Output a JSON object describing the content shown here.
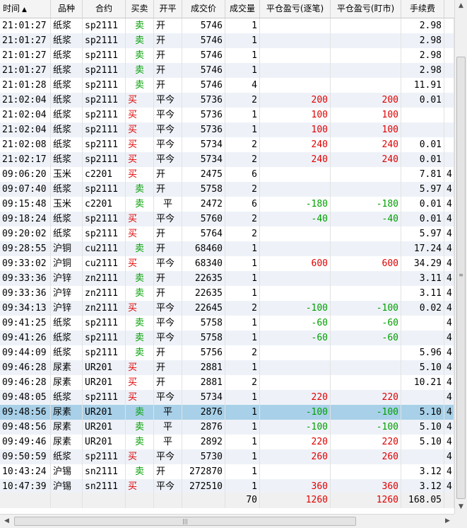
{
  "columns": [
    "时间",
    "品种",
    "合约",
    "买卖",
    "开平",
    "成交价",
    "成交量",
    "平仓盈亏(逐笔)",
    "平仓盈亏(盯市)",
    "手续费"
  ],
  "sort_indicator": "▲",
  "rows": [
    {
      "time": "21:01:27",
      "product": "纸浆",
      "contract": "sp2111",
      "side": "卖",
      "oc": "开",
      "price": "5746",
      "qty": "1",
      "pnl_trade": "",
      "pnl_mtm": "",
      "fee": "2.98",
      "extra": ""
    },
    {
      "time": "21:01:27",
      "product": "纸浆",
      "contract": "sp2111",
      "side": "卖",
      "oc": "开",
      "price": "5746",
      "qty": "1",
      "pnl_trade": "",
      "pnl_mtm": "",
      "fee": "2.98",
      "extra": ""
    },
    {
      "time": "21:01:27",
      "product": "纸浆",
      "contract": "sp2111",
      "side": "卖",
      "oc": "开",
      "price": "5746",
      "qty": "1",
      "pnl_trade": "",
      "pnl_mtm": "",
      "fee": "2.98",
      "extra": ""
    },
    {
      "time": "21:01:27",
      "product": "纸浆",
      "contract": "sp2111",
      "side": "卖",
      "oc": "开",
      "price": "5746",
      "qty": "1",
      "pnl_trade": "",
      "pnl_mtm": "",
      "fee": "2.98",
      "extra": ""
    },
    {
      "time": "21:01:28",
      "product": "纸浆",
      "contract": "sp2111",
      "side": "卖",
      "oc": "开",
      "price": "5746",
      "qty": "4",
      "pnl_trade": "",
      "pnl_mtm": "",
      "fee": "11.91",
      "extra": ""
    },
    {
      "time": "21:02:04",
      "product": "纸浆",
      "contract": "sp2111",
      "side": "买",
      "oc": "平今",
      "price": "5736",
      "qty": "2",
      "pnl_trade": "200",
      "pnl_mtm": "200",
      "fee": "0.01",
      "extra": ""
    },
    {
      "time": "21:02:04",
      "product": "纸浆",
      "contract": "sp2111",
      "side": "买",
      "oc": "平今",
      "price": "5736",
      "qty": "1",
      "pnl_trade": "100",
      "pnl_mtm": "100",
      "fee": "",
      "extra": ""
    },
    {
      "time": "21:02:04",
      "product": "纸浆",
      "contract": "sp2111",
      "side": "买",
      "oc": "平今",
      "price": "5736",
      "qty": "1",
      "pnl_trade": "100",
      "pnl_mtm": "100",
      "fee": "",
      "extra": ""
    },
    {
      "time": "21:02:08",
      "product": "纸浆",
      "contract": "sp2111",
      "side": "买",
      "oc": "平今",
      "price": "5734",
      "qty": "2",
      "pnl_trade": "240",
      "pnl_mtm": "240",
      "fee": "0.01",
      "extra": ""
    },
    {
      "time": "21:02:17",
      "product": "纸浆",
      "contract": "sp2111",
      "side": "买",
      "oc": "平今",
      "price": "5734",
      "qty": "2",
      "pnl_trade": "240",
      "pnl_mtm": "240",
      "fee": "0.01",
      "extra": ""
    },
    {
      "time": "09:06:20",
      "product": "玉米",
      "contract": "c2201",
      "side": "买",
      "oc": "开",
      "price": "2475",
      "qty": "6",
      "pnl_trade": "",
      "pnl_mtm": "",
      "fee": "7.81",
      "extra": "4"
    },
    {
      "time": "09:07:40",
      "product": "纸浆",
      "contract": "sp2111",
      "side": "卖",
      "oc": "开",
      "price": "5758",
      "qty": "2",
      "pnl_trade": "",
      "pnl_mtm": "",
      "fee": "5.97",
      "extra": "4"
    },
    {
      "time": "09:15:48",
      "product": "玉米",
      "contract": "c2201",
      "side": "卖",
      "oc": "平",
      "price": "2472",
      "qty": "6",
      "pnl_trade": "-180",
      "pnl_mtm": "-180",
      "fee": "0.01",
      "extra": "4"
    },
    {
      "time": "09:18:24",
      "product": "纸浆",
      "contract": "sp2111",
      "side": "买",
      "oc": "平今",
      "price": "5760",
      "qty": "2",
      "pnl_trade": "-40",
      "pnl_mtm": "-40",
      "fee": "0.01",
      "extra": "4"
    },
    {
      "time": "09:20:02",
      "product": "纸浆",
      "contract": "sp2111",
      "side": "买",
      "oc": "开",
      "price": "5764",
      "qty": "2",
      "pnl_trade": "",
      "pnl_mtm": "",
      "fee": "5.97",
      "extra": "4"
    },
    {
      "time": "09:28:55",
      "product": "沪铜",
      "contract": "cu2111",
      "side": "卖",
      "oc": "开",
      "price": "68460",
      "qty": "1",
      "pnl_trade": "",
      "pnl_mtm": "",
      "fee": "17.24",
      "extra": "4"
    },
    {
      "time": "09:33:02",
      "product": "沪铜",
      "contract": "cu2111",
      "side": "买",
      "oc": "平今",
      "price": "68340",
      "qty": "1",
      "pnl_trade": "600",
      "pnl_mtm": "600",
      "fee": "34.29",
      "extra": "4"
    },
    {
      "time": "09:33:36",
      "product": "沪锌",
      "contract": "zn2111",
      "side": "卖",
      "oc": "开",
      "price": "22635",
      "qty": "1",
      "pnl_trade": "",
      "pnl_mtm": "",
      "fee": "3.11",
      "extra": "4"
    },
    {
      "time": "09:33:36",
      "product": "沪锌",
      "contract": "zn2111",
      "side": "卖",
      "oc": "开",
      "price": "22635",
      "qty": "1",
      "pnl_trade": "",
      "pnl_mtm": "",
      "fee": "3.11",
      "extra": "4"
    },
    {
      "time": "09:34:13",
      "product": "沪锌",
      "contract": "zn2111",
      "side": "买",
      "oc": "平今",
      "price": "22645",
      "qty": "2",
      "pnl_trade": "-100",
      "pnl_mtm": "-100",
      "fee": "0.02",
      "extra": "4"
    },
    {
      "time": "09:41:25",
      "product": "纸浆",
      "contract": "sp2111",
      "side": "卖",
      "oc": "平今",
      "price": "5758",
      "qty": "1",
      "pnl_trade": "-60",
      "pnl_mtm": "-60",
      "fee": "",
      "extra": "4"
    },
    {
      "time": "09:41:26",
      "product": "纸浆",
      "contract": "sp2111",
      "side": "卖",
      "oc": "平今",
      "price": "5758",
      "qty": "1",
      "pnl_trade": "-60",
      "pnl_mtm": "-60",
      "fee": "",
      "extra": "4"
    },
    {
      "time": "09:44:09",
      "product": "纸浆",
      "contract": "sp2111",
      "side": "卖",
      "oc": "开",
      "price": "5756",
      "qty": "2",
      "pnl_trade": "",
      "pnl_mtm": "",
      "fee": "5.96",
      "extra": "4"
    },
    {
      "time": "09:46:28",
      "product": "尿素",
      "contract": "UR201",
      "side": "买",
      "oc": "开",
      "price": "2881",
      "qty": "1",
      "pnl_trade": "",
      "pnl_mtm": "",
      "fee": "5.10",
      "extra": "4"
    },
    {
      "time": "09:46:28",
      "product": "尿素",
      "contract": "UR201",
      "side": "买",
      "oc": "开",
      "price": "2881",
      "qty": "2",
      "pnl_trade": "",
      "pnl_mtm": "",
      "fee": "10.21",
      "extra": "4"
    },
    {
      "time": "09:48:05",
      "product": "纸浆",
      "contract": "sp2111",
      "side": "买",
      "oc": "平今",
      "price": "5734",
      "qty": "1",
      "pnl_trade": "220",
      "pnl_mtm": "220",
      "fee": "",
      "extra": "4"
    },
    {
      "time": "09:48:56",
      "product": "尿素",
      "contract": "UR201",
      "side": "卖",
      "oc": "平",
      "price": "2876",
      "qty": "1",
      "pnl_trade": "-100",
      "pnl_mtm": "-100",
      "fee": "5.10",
      "extra": "4",
      "selected": true
    },
    {
      "time": "09:48:56",
      "product": "尿素",
      "contract": "UR201",
      "side": "卖",
      "oc": "平",
      "price": "2876",
      "qty": "1",
      "pnl_trade": "-100",
      "pnl_mtm": "-100",
      "fee": "5.10",
      "extra": "4"
    },
    {
      "time": "09:49:46",
      "product": "尿素",
      "contract": "UR201",
      "side": "卖",
      "oc": "平",
      "price": "2892",
      "qty": "1",
      "pnl_trade": "220",
      "pnl_mtm": "220",
      "fee": "5.10",
      "extra": "4"
    },
    {
      "time": "09:50:59",
      "product": "纸浆",
      "contract": "sp2111",
      "side": "买",
      "oc": "平今",
      "price": "5730",
      "qty": "1",
      "pnl_trade": "260",
      "pnl_mtm": "260",
      "fee": "",
      "extra": "4"
    },
    {
      "time": "10:43:24",
      "product": "沪锡",
      "contract": "sn2111",
      "side": "卖",
      "oc": "开",
      "price": "272870",
      "qty": "1",
      "pnl_trade": "",
      "pnl_mtm": "",
      "fee": "3.12",
      "extra": "4"
    },
    {
      "time": "10:47:39",
      "product": "沪锡",
      "contract": "sn2111",
      "side": "买",
      "oc": "平今",
      "price": "272510",
      "qty": "1",
      "pnl_trade": "360",
      "pnl_mtm": "360",
      "fee": "3.12",
      "extra": "4"
    }
  ],
  "totals": {
    "qty": "70",
    "pnl_trade": "1260",
    "pnl_mtm": "1260",
    "fee": "168.05"
  },
  "colors": {
    "buy": "#e00000",
    "sell": "#00a000",
    "profit": "#e00000",
    "loss": "#00a000",
    "selected_row": "#a8d0e8",
    "alt_row": "#eef2f8"
  },
  "icons": {
    "scroll_up": "▲",
    "scroll_down": "▼",
    "scroll_left": "◀",
    "scroll_right": "▶",
    "grip_v": "≡",
    "grip_h": "|||"
  }
}
